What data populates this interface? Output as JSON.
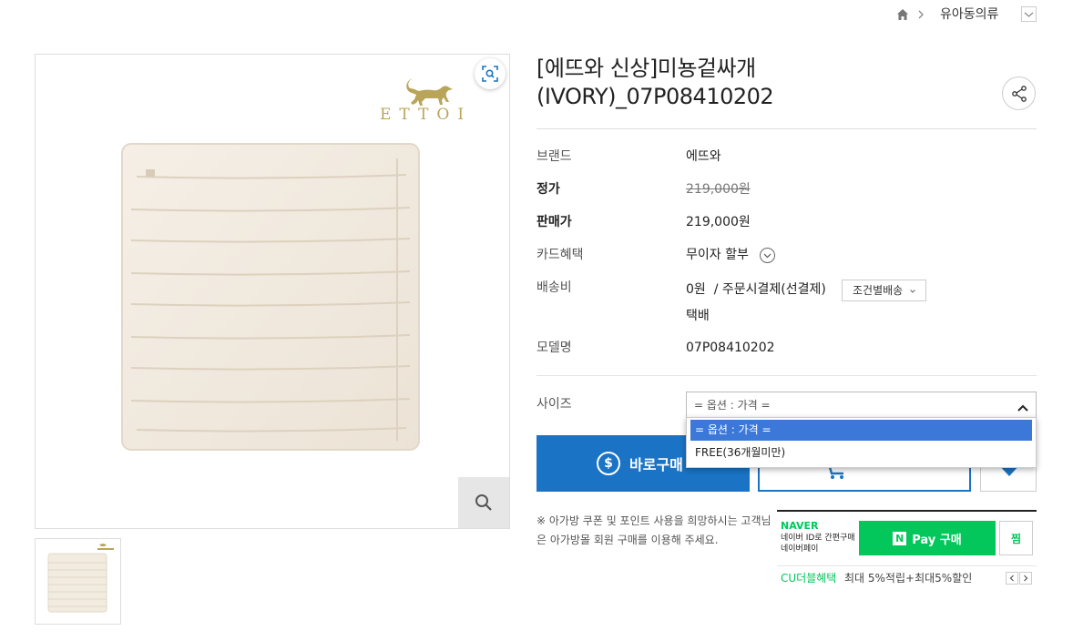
{
  "breadcrumb": {
    "category": "유아동의류"
  },
  "product": {
    "title": "[에뜨와 신상]미뇽겉싸개(IVORY)_07P08410202",
    "brand_logo": "ETTOI"
  },
  "info": {
    "brand_label": "브랜드",
    "brand_value": "에뜨와",
    "list_price_label": "정가",
    "list_price": "219,000원",
    "sale_price_label": "판매가",
    "sale_price": "219,000원",
    "card_label": "카드혜택",
    "card_value": "무이자 할부",
    "shipping_label": "배송비",
    "shipping_value": "0원  / 주문시결제(선결제)",
    "shipping_button": "조건별배송",
    "shipping_method": "택배",
    "model_label": "모델명",
    "model_value": "07P08410202"
  },
  "option": {
    "label": "사이즈",
    "selected": "= 옵션 : 가격 =",
    "options": [
      "= 옵션 : 가격 =",
      "FREE(36개월미만)"
    ]
  },
  "actions": {
    "buy_now": "바로구매"
  },
  "notice": "※ 아가방 쿠폰 및 포인트 사용을 희망하시는 고객님은 아가방몰 회원 구매를 이용해 주세요.",
  "naver": {
    "brand": "NAVER",
    "desc": "네이버 ID로 간편구매 네이버페이",
    "pay_label": "Pay 구매",
    "wish_label": "찜",
    "benefit_label": "CU더블혜택",
    "benefit_text": "최대 5%적립+최대5%할인"
  },
  "colors": {
    "accent": "#1a73c4",
    "naver_green": "#03c75a",
    "option_highlight": "#3c78d8"
  }
}
